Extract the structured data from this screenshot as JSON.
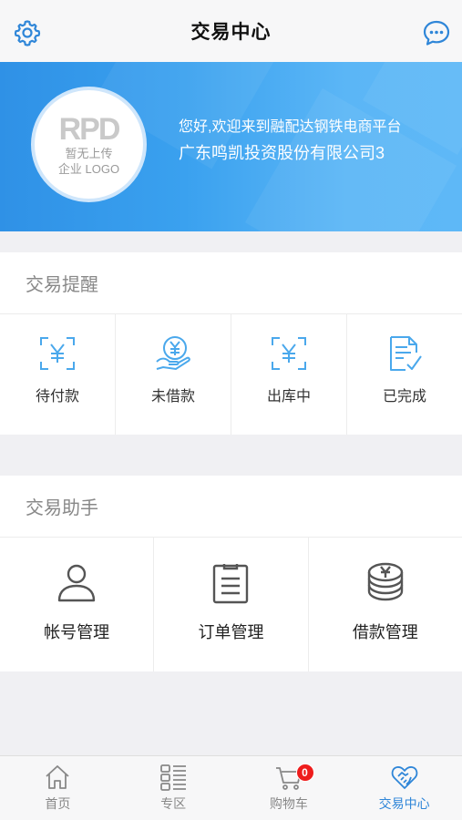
{
  "header": {
    "title": "交易中心",
    "left_icon": "gear-icon",
    "right_icon": "chat-bubble-icon"
  },
  "banner": {
    "logo_mark": "RPD",
    "logo_line1": "暂无上传",
    "logo_line2": "企业 LOGO",
    "welcome": "您好,欢迎来到融配达钢铁电商平台",
    "company": "广东鸣凯投资股份有限公司3"
  },
  "reminders": {
    "title": "交易提醒",
    "items": [
      {
        "label": "待付款",
        "icon": "yen-scan-icon"
      },
      {
        "label": "未借款",
        "icon": "yen-hand-icon"
      },
      {
        "label": "出库中",
        "icon": "yen-scan-icon"
      },
      {
        "label": "已完成",
        "icon": "document-check-icon"
      }
    ]
  },
  "assistant": {
    "title": "交易助手",
    "items": [
      {
        "label": "帐号管理",
        "icon": "user-icon"
      },
      {
        "label": "订单管理",
        "icon": "clipboard-icon"
      },
      {
        "label": "借款管理",
        "icon": "coin-stack-icon"
      }
    ]
  },
  "tabbar": {
    "tabs": [
      {
        "label": "首页",
        "icon": "home-icon"
      },
      {
        "label": "专区",
        "icon": "grid-list-icon"
      },
      {
        "label": "购物车",
        "icon": "cart-icon",
        "badge": "0"
      },
      {
        "label": "交易中心",
        "icon": "heart-handshake-icon",
        "active": true
      }
    ]
  },
  "colors": {
    "accent": "#2f86d8",
    "banner_start": "#2f91e6",
    "banner_end": "#5eb8f7",
    "badge": "#ee1c1c"
  }
}
